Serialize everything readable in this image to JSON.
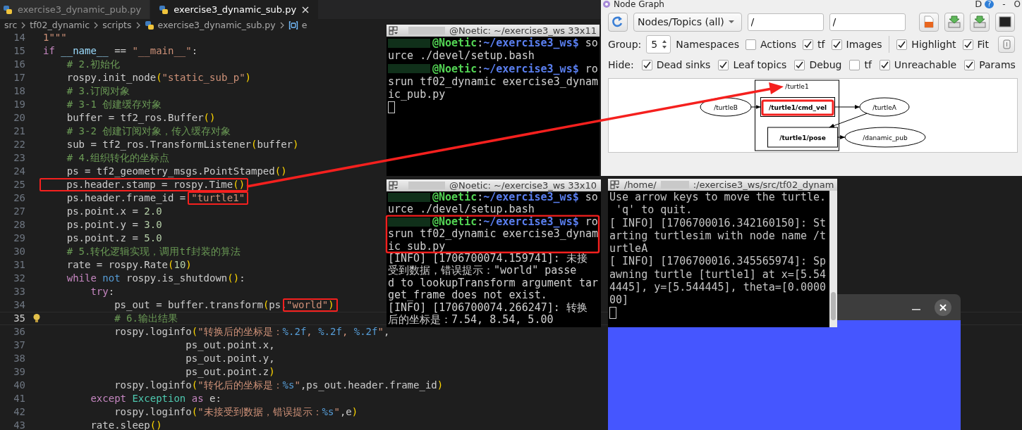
{
  "editor": {
    "tabs": [
      {
        "label": "exercise3_dynamic_pub.py",
        "selected": false
      },
      {
        "label": "exercise3_dynamic_sub.py",
        "selected": true
      }
    ],
    "breadcrumbs": [
      {
        "kind": "folder",
        "label": "src"
      },
      {
        "kind": "folder",
        "label": "tf02_dynamic"
      },
      {
        "kind": "folder",
        "label": "scripts"
      },
      {
        "kind": "file",
        "label": "exercise3_dynamic_sub.py"
      },
      {
        "kind": "symbol",
        "label": "e"
      }
    ],
    "lines": [
      {
        "number": "14",
        "current": false,
        "tokens": [
          {
            "kind": "string",
            "text": "1\"\"\"",
            "annotated": false
          }
        ]
      },
      {
        "number": "15",
        "current": false,
        "tokens": [
          {
            "kind": "keyword",
            "text": "if",
            "annotated": false
          },
          {
            "kind": "variable",
            "text": " __name__",
            "annotated": false
          },
          {
            "kind": "plain",
            "text": " == ",
            "annotated": false
          },
          {
            "kind": "string",
            "text": "\"__main__\"",
            "annotated": false
          },
          {
            "kind": "plain",
            "text": ":",
            "annotated": false
          }
        ]
      },
      {
        "number": "16",
        "current": false,
        "tokens": [
          {
            "kind": "comment",
            "text": "    # 2.初始化",
            "annotated": false
          }
        ]
      },
      {
        "number": "17",
        "current": false,
        "tokens": [
          {
            "kind": "plain",
            "text": "    rospy.init_node",
            "annotated": false
          },
          {
            "kind": "bracket",
            "text": "(",
            "annotated": false
          },
          {
            "kind": "string",
            "text": "\"static_sub_p\"",
            "annotated": false
          },
          {
            "kind": "bracket",
            "text": ")",
            "annotated": false
          }
        ]
      },
      {
        "number": "18",
        "current": false,
        "tokens": [
          {
            "kind": "comment",
            "text": "    # 3.订阅对象",
            "annotated": false
          }
        ]
      },
      {
        "number": "19",
        "current": false,
        "tokens": [
          {
            "kind": "comment",
            "text": "    # 3-1 创建缓存对象",
            "annotated": false
          }
        ]
      },
      {
        "number": "20",
        "current": false,
        "tokens": [
          {
            "kind": "plain",
            "text": "    buffer = tf2_ros.Buffer",
            "annotated": false
          },
          {
            "kind": "bracket",
            "text": "()",
            "annotated": false
          }
        ]
      },
      {
        "number": "21",
        "current": false,
        "tokens": [
          {
            "kind": "comment",
            "text": "    # 3-2 创建订阅对象，传入缓存对象",
            "annotated": false
          }
        ]
      },
      {
        "number": "22",
        "current": false,
        "tokens": [
          {
            "kind": "plain",
            "text": "    sub = tf2_ros.TransformListener",
            "annotated": false
          },
          {
            "kind": "bracket",
            "text": "(",
            "annotated": false
          },
          {
            "kind": "plain",
            "text": "buffer",
            "annotated": false
          },
          {
            "kind": "bracket",
            "text": ")",
            "annotated": false
          }
        ]
      },
      {
        "number": "23",
        "current": false,
        "tokens": [
          {
            "kind": "comment",
            "text": "    # 4.组织转化的坐标点",
            "annotated": false
          }
        ]
      },
      {
        "number": "24",
        "current": false,
        "tokens": [
          {
            "kind": "plain",
            "text": "    ps = tf2_geometry_msgs.PointStamped",
            "annotated": false
          },
          {
            "kind": "bracket",
            "text": "()",
            "annotated": false
          }
        ]
      },
      {
        "number": "25",
        "current": false,
        "tokens": [
          {
            "kind": "plain",
            "text": "    ps.header.stamp = rospy.Time",
            "annotated": true
          },
          {
            "kind": "bracket",
            "text": "()",
            "annotated": true
          }
        ]
      },
      {
        "number": "26",
        "current": false,
        "tokens": [
          {
            "kind": "plain",
            "text": "    ps.header.frame_id = ",
            "annotated": false
          },
          {
            "kind": "string",
            "text": "\"turtle1\"",
            "annotated": true
          }
        ]
      },
      {
        "number": "27",
        "current": false,
        "tokens": [
          {
            "kind": "plain",
            "text": "    ps.point.x = ",
            "annotated": false
          },
          {
            "kind": "number",
            "text": "2.0",
            "annotated": false
          }
        ]
      },
      {
        "number": "28",
        "current": false,
        "tokens": [
          {
            "kind": "plain",
            "text": "    ps.point.y = ",
            "annotated": false
          },
          {
            "kind": "number",
            "text": "3.0",
            "annotated": false
          }
        ]
      },
      {
        "number": "29",
        "current": false,
        "tokens": [
          {
            "kind": "plain",
            "text": "    ps.point.z = ",
            "annotated": false
          },
          {
            "kind": "number",
            "text": "5.0",
            "annotated": false
          }
        ]
      },
      {
        "number": "30",
        "current": false,
        "tokens": [
          {
            "kind": "comment",
            "text": "    # 5.转化逻辑实现，调用tf封装的算法",
            "annotated": false
          }
        ]
      },
      {
        "number": "31",
        "current": false,
        "tokens": [
          {
            "kind": "plain",
            "text": "    rate = rospy.Rate",
            "annotated": false
          },
          {
            "kind": "bracket",
            "text": "(",
            "annotated": false
          },
          {
            "kind": "number",
            "text": "10",
            "annotated": false
          },
          {
            "kind": "bracket",
            "text": ")",
            "annotated": false
          }
        ]
      },
      {
        "number": "32",
        "current": false,
        "tokens": [
          {
            "kind": "keyword",
            "text": "    while",
            "annotated": false
          },
          {
            "kind": "operator",
            "text": " not",
            "annotated": false
          },
          {
            "kind": "plain",
            "text": " rospy.is_shutdown",
            "annotated": false
          },
          {
            "kind": "bracket",
            "text": "()",
            "annotated": false
          },
          {
            "kind": "plain",
            "text": ":",
            "annotated": false
          }
        ]
      },
      {
        "number": "33",
        "current": false,
        "tokens": [
          {
            "kind": "keyword",
            "text": "        try",
            "annotated": false
          },
          {
            "kind": "plain",
            "text": ":",
            "annotated": false
          }
        ]
      },
      {
        "number": "34",
        "current": false,
        "tokens": [
          {
            "kind": "plain",
            "text": "            ps_out = buffer.transform",
            "annotated": false
          },
          {
            "kind": "bracket",
            "text": "(",
            "annotated": false
          },
          {
            "kind": "plain",
            "text": "ps,",
            "annotated": false
          },
          {
            "kind": "string",
            "text": "\"world\"",
            "annotated": true
          },
          {
            "kind": "bracket",
            "text": ")",
            "annotated": true
          }
        ]
      },
      {
        "number": "35",
        "current": true,
        "tokens": [
          {
            "kind": "comment",
            "text": "            # 6.输出结果",
            "annotated": false
          }
        ]
      },
      {
        "number": "36",
        "current": false,
        "tokens": [
          {
            "kind": "plain",
            "text": "            rospy.loginfo",
            "annotated": false
          },
          {
            "kind": "bracket",
            "text": "(",
            "annotated": false
          },
          {
            "kind": "string",
            "text": "\"转换后的坐标是：",
            "annotated": false
          },
          {
            "kind": "format",
            "text": "%.2f",
            "annotated": false
          },
          {
            "kind": "string",
            "text": ", ",
            "annotated": false
          },
          {
            "kind": "format",
            "text": "%.2f",
            "annotated": false
          },
          {
            "kind": "string",
            "text": ", ",
            "annotated": false
          },
          {
            "kind": "format",
            "text": "%.2f",
            "annotated": false
          },
          {
            "kind": "string",
            "text": "\"",
            "annotated": false
          },
          {
            "kind": "plain",
            "text": ",",
            "annotated": false
          }
        ]
      },
      {
        "number": "37",
        "current": false,
        "tokens": [
          {
            "kind": "plain",
            "text": "                        ps_out.point.x,",
            "annotated": false
          }
        ]
      },
      {
        "number": "38",
        "current": false,
        "tokens": [
          {
            "kind": "plain",
            "text": "                        ps_out.point.y,",
            "annotated": false
          }
        ]
      },
      {
        "number": "39",
        "current": false,
        "tokens": [
          {
            "kind": "plain",
            "text": "                        ps_out.point.z",
            "annotated": false
          },
          {
            "kind": "bracket",
            "text": ")",
            "annotated": false
          }
        ]
      },
      {
        "number": "40",
        "current": false,
        "tokens": [
          {
            "kind": "plain",
            "text": "            rospy.loginfo",
            "annotated": false
          },
          {
            "kind": "bracket",
            "text": "(",
            "annotated": false
          },
          {
            "kind": "string",
            "text": "\"转化后的坐标是：",
            "annotated": false
          },
          {
            "kind": "format",
            "text": "%s",
            "annotated": false
          },
          {
            "kind": "string",
            "text": "\"",
            "annotated": false
          },
          {
            "kind": "plain",
            "text": ",ps_out.header.frame_id",
            "annotated": false
          },
          {
            "kind": "bracket",
            "text": ")",
            "annotated": false
          }
        ]
      },
      {
        "number": "41",
        "current": false,
        "tokens": [
          {
            "kind": "keyword",
            "text": "        except",
            "annotated": false
          },
          {
            "kind": "type",
            "text": " Exception",
            "annotated": false
          },
          {
            "kind": "keyword",
            "text": " as",
            "annotated": false
          },
          {
            "kind": "plain",
            "text": " e:",
            "annotated": false
          }
        ]
      },
      {
        "number": "42",
        "current": false,
        "tokens": [
          {
            "kind": "plain",
            "text": "            rospy.loginfo",
            "annotated": false
          },
          {
            "kind": "bracket",
            "text": "(",
            "annotated": false
          },
          {
            "kind": "string",
            "text": "\"未接受到数据，错误提示：",
            "annotated": false
          },
          {
            "kind": "format",
            "text": "%s",
            "annotated": false
          },
          {
            "kind": "string",
            "text": "\"",
            "annotated": false
          },
          {
            "kind": "plain",
            "text": ",e",
            "annotated": false
          },
          {
            "kind": "bracket",
            "text": ")",
            "annotated": false
          }
        ]
      },
      {
        "number": "43",
        "current": false,
        "tokens": [
          {
            "kind": "plain",
            "text": "        rate.sleep",
            "annotated": false
          },
          {
            "kind": "bracket",
            "text": "()",
            "annotated": false
          }
        ]
      }
    ]
  },
  "terminals": [
    {
      "title": "@Noetic: ~/exercise3_ws 33x11",
      "scrollbar": false,
      "lines": [
        {
          "kind": "prompt",
          "user_host": "@Noetic",
          "separator": ":",
          "path": "~/exercise3_ws$",
          "command": "so"
        },
        {
          "kind": "output",
          "text": "urce ./devel/setup.bash"
        },
        {
          "kind": "prompt",
          "user_host": "@Noetic",
          "separator": ":",
          "path": "~/exercise3_ws$",
          "command": "ro"
        },
        {
          "kind": "output",
          "text": "srun tf02_dynamic exercise3_dynam"
        },
        {
          "kind": "output",
          "text": "ic_pub.py"
        },
        {
          "kind": "cursor"
        }
      ]
    },
    {
      "title": "@Noetic: ~/exercise3_ws 33x10",
      "scrollbar": false,
      "lines": [
        {
          "kind": "prompt",
          "user_host": "@Noetic",
          "separator": ":",
          "path": "~/exercise3_ws$",
          "command": "so"
        },
        {
          "kind": "output",
          "text": "urce ./devel/setup.bash"
        },
        {
          "kind": "prompt",
          "user_host": "@Noetic",
          "separator": ":",
          "path": "~/exercise3_ws$",
          "command": "ro"
        },
        {
          "kind": "output",
          "text": "srun tf02_dynamic exercise3_dynam"
        },
        {
          "kind": "output",
          "text": "ic_sub.py"
        },
        {
          "kind": "output",
          "text": "[INFO] [1706700074.159741]: 未接"
        },
        {
          "kind": "output",
          "text": "受到数据，错误提示：\"world\" passe"
        },
        {
          "kind": "output",
          "text": "d to lookupTransform argument tar"
        },
        {
          "kind": "output",
          "text": "get_frame does not exist."
        },
        {
          "kind": "output",
          "text": "[INFO] [1706700074.266247]: 转换"
        },
        {
          "kind": "output",
          "text": "后的坐标是：7.54, 8.54, 5.00"
        }
      ]
    },
    {
      "title_head": "/home/",
      "title": ":/exercise3_ws/src/tf02_dynam",
      "scrollbar": true,
      "lines": [
        {
          "kind": "output",
          "text": "Use arrow keys to move the turtle."
        },
        {
          "kind": "output",
          "text": " 'q' to quit."
        },
        {
          "kind": "output",
          "text": "[ INFO] [1706700016.342160150]: St"
        },
        {
          "kind": "output",
          "text": "arting turtlesim with node name /t"
        },
        {
          "kind": "output",
          "text": "urtleA"
        },
        {
          "kind": "output",
          "text": "[ INFO] [1706700016.345565974]: Sp"
        },
        {
          "kind": "output",
          "text": "awning turtle [turtle1] at x=[5.54"
        },
        {
          "kind": "output",
          "text": "4445], y=[5.544445], theta=[0.0000"
        },
        {
          "kind": "output",
          "text": "00]"
        },
        {
          "kind": "cursor"
        }
      ]
    }
  ],
  "node_graph": {
    "title": "Node Graph",
    "title_buttons": [
      "D"
    ],
    "help": "?",
    "window_controls": [
      "-",
      "O"
    ],
    "filter": "Nodes/Topics (all)",
    "namespace_filter": "/",
    "topic_filter": "/",
    "group_label": "Group:",
    "group_value": "5",
    "namespaces_label": "Namespaces",
    "options": [
      {
        "label": "Actions",
        "checked": false
      },
      {
        "label": "tf",
        "checked": true
      },
      {
        "label": "Images",
        "checked": true
      }
    ],
    "view_options": [
      {
        "label": "Highlight",
        "checked": true
      },
      {
        "label": "Fit",
        "checked": true
      }
    ],
    "hide_label": "Hide:",
    "hide_options": [
      {
        "label": "Dead sinks",
        "checked": true
      },
      {
        "label": "Leaf topics",
        "checked": true
      },
      {
        "label": "Debug",
        "checked": true
      },
      {
        "label": "tf",
        "checked": false
      },
      {
        "label": "Unreachable",
        "checked": true
      },
      {
        "label": "Params",
        "checked": true
      }
    ],
    "graph": {
      "nodes": [
        {
          "kind": "namespace",
          "label": "/turtle1"
        },
        {
          "kind": "node",
          "label": "/turtleB"
        },
        {
          "kind": "topic",
          "label": "/turtle1/cmd_vel"
        },
        {
          "kind": "node",
          "label": "/turtleA"
        },
        {
          "kind": "topic",
          "label": "/turtle1/pose"
        },
        {
          "kind": "node",
          "label": "/danamic_pub"
        }
      ]
    }
  }
}
